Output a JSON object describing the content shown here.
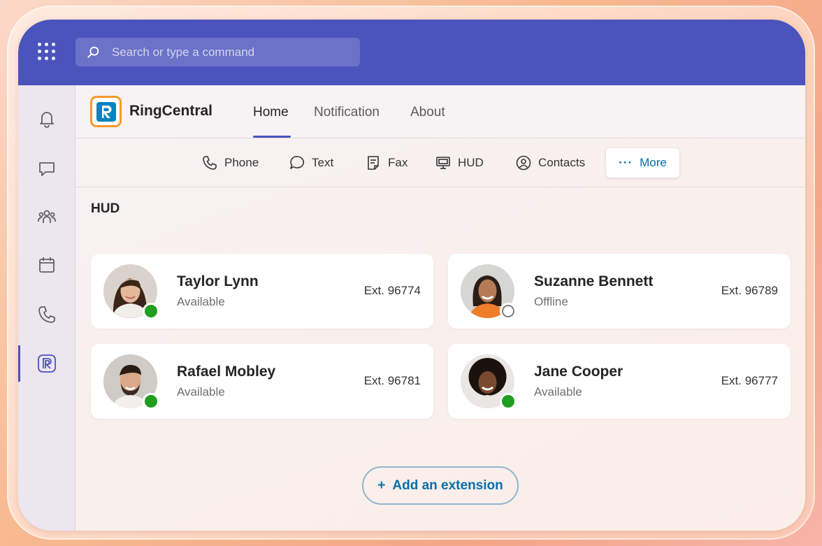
{
  "search": {
    "placeholder": "Search or type a command"
  },
  "rail": [
    "bell-icon",
    "chat-icon",
    "people-icon",
    "calendar-icon",
    "phone-icon",
    "ringcentral-app-icon"
  ],
  "app": {
    "brand": "RingCentral",
    "tabs": [
      {
        "label": "Home",
        "active": true
      },
      {
        "label": "Notification",
        "active": false
      },
      {
        "label": "About",
        "active": false
      }
    ]
  },
  "toolbar": {
    "phone": "Phone",
    "text": "Text",
    "fax": "Fax",
    "hud": "HUD",
    "contacts": "Contacts",
    "more": "More"
  },
  "section": {
    "title": "HUD"
  },
  "contacts": [
    {
      "name": "Taylor Lynn",
      "status": "Available",
      "ext": "Ext. 96774"
    },
    {
      "name": "Suzanne Bennett",
      "status": "Offline",
      "ext": "Ext. 96789"
    },
    {
      "name": "Rafael Mobley",
      "status": "Available",
      "ext": "Ext. 96781"
    },
    {
      "name": "Jane Cooper",
      "status": "Available",
      "ext": "Ext. 96777"
    }
  ],
  "add_button": {
    "plus": "+",
    "label": "Add an extension"
  },
  "colors": {
    "topbar": "#4b53bc",
    "available": "#1f9e1f",
    "link": "#066fac",
    "logo_orange": "#f39a2b",
    "logo_blue": "#0684bc"
  }
}
